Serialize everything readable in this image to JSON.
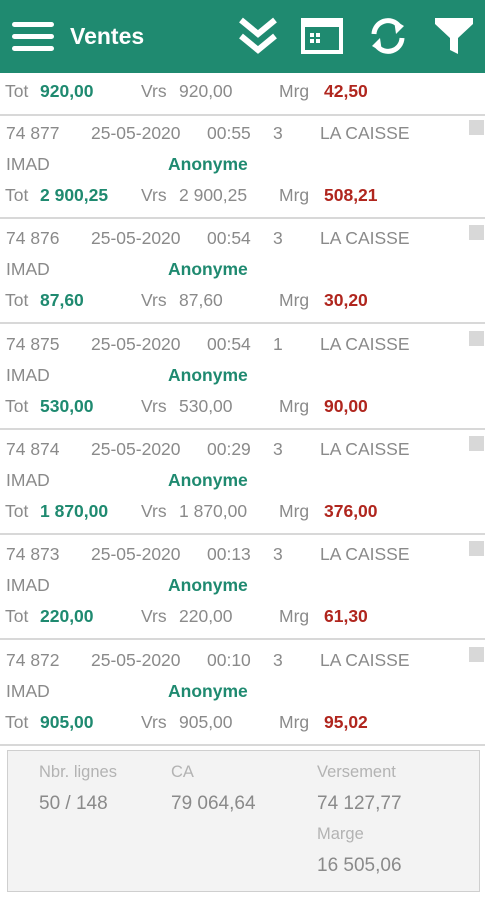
{
  "appbar": {
    "title": "Ventes",
    "menu_icon": "hamburger-menu-icon",
    "actions": [
      "chevron-double-down-icon",
      "card-view-icon",
      "sync-icon",
      "filter-icon"
    ],
    "color": "#1f8a70"
  },
  "labels": {
    "tot": "Tot",
    "vrs": "Vrs",
    "mrg": "Mrg"
  },
  "top_partial": {
    "tot": "920,00",
    "vrs": "920,00",
    "mrg": "42,50"
  },
  "sales": [
    {
      "num": "74 877",
      "date": "25-05-2020",
      "time": "00:55",
      "count": "3",
      "register": "LA CAISSE",
      "user": "IMAD",
      "client": "Anonyme",
      "tot": "2 900,25",
      "vrs": "2 900,25",
      "mrg": "508,21"
    },
    {
      "num": "74 876",
      "date": "25-05-2020",
      "time": "00:54",
      "count": "3",
      "register": "LA CAISSE",
      "user": "IMAD",
      "client": "Anonyme",
      "tot": "87,60",
      "vrs": "87,60",
      "mrg": "30,20"
    },
    {
      "num": "74 875",
      "date": "25-05-2020",
      "time": "00:54",
      "count": "1",
      "register": "LA CAISSE",
      "user": "IMAD",
      "client": "Anonyme",
      "tot": "530,00",
      "vrs": "530,00",
      "mrg": "90,00"
    },
    {
      "num": "74 874",
      "date": "25-05-2020",
      "time": "00:29",
      "count": "3",
      "register": "LA CAISSE",
      "user": "IMAD",
      "client": "Anonyme",
      "tot": "1 870,00",
      "vrs": "1 870,00",
      "mrg": "376,00"
    },
    {
      "num": "74 873",
      "date": "25-05-2020",
      "time": "00:13",
      "count": "3",
      "register": "LA CAISSE",
      "user": "IMAD",
      "client": "Anonyme",
      "tot": "220,00",
      "vrs": "220,00",
      "mrg": "61,30"
    },
    {
      "num": "74 872",
      "date": "25-05-2020",
      "time": "00:10",
      "count": "3",
      "register": "LA CAISSE",
      "user": "IMAD",
      "client": "Anonyme",
      "tot": "905,00",
      "vrs": "905,00",
      "mrg": "95,02"
    }
  ],
  "summary": {
    "lines_label": "Nbr. lignes",
    "lines_value": "50 / 148",
    "ca_label": "CA",
    "ca_value": "79 064,64",
    "versement_label": "Versement",
    "versement_value": "74 127,77",
    "marge_label": "Marge",
    "marge_value": "16 505,06"
  },
  "colors": {
    "total": "#1f8a70",
    "margin": "#b0261e"
  }
}
